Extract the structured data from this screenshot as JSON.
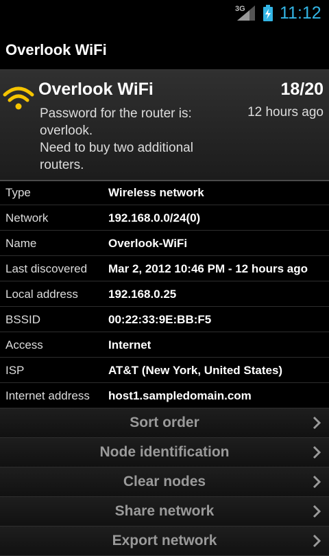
{
  "status_bar": {
    "network_type": "3G",
    "time": "11:12"
  },
  "action_bar": {
    "title": "Overlook WiFi"
  },
  "network": {
    "name": "Overlook WiFi",
    "count": "18/20",
    "age": "12 hours ago",
    "note_lines": [
      "Password for the router is:",
      "overlook.",
      "Need to buy two additional",
      "routers."
    ]
  },
  "details": [
    {
      "label": "Type",
      "value": "Wireless network"
    },
    {
      "label": "Network",
      "value": "192.168.0.0/24(0)"
    },
    {
      "label": "Name",
      "value": "Overlook-WiFi"
    },
    {
      "label": "Last discovered",
      "value": "Mar 2, 2012 10:46 PM - 12 hours ago"
    },
    {
      "label": "Local address",
      "value": "192.168.0.25"
    },
    {
      "label": "BSSID",
      "value": "00:22:33:9E:BB:F5"
    },
    {
      "label": "Access",
      "value": "Internet"
    },
    {
      "label": "ISP",
      "value": "AT&T (New York, United States)"
    },
    {
      "label": "Internet address",
      "value": "host1.sampledomain.com"
    }
  ],
  "menu": [
    {
      "label": "Sort order"
    },
    {
      "label": "Node identification"
    },
    {
      "label": "Clear nodes"
    },
    {
      "label": "Share network"
    },
    {
      "label": "Export network"
    }
  ],
  "colors": {
    "accent": "#33b5e5",
    "wifi_icon": "#f5c400"
  },
  "icons": [
    "signal-icon",
    "battery-icon",
    "wifi-icon",
    "chevron-right-icon"
  ]
}
